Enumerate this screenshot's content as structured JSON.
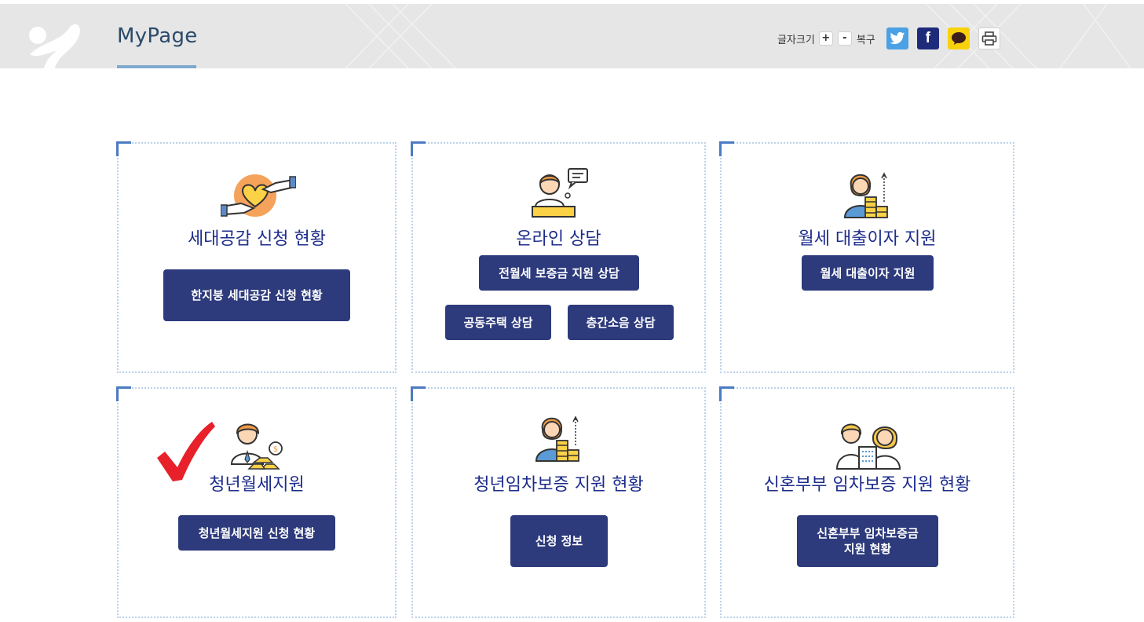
{
  "header": {
    "title": "MyPage",
    "font_size_label": "글자크기",
    "font_plus": "+",
    "font_minus": "-",
    "font_reset": "복구",
    "share_icons": [
      "twitter-icon",
      "facebook-icon",
      "kakaotalk-icon",
      "print-icon"
    ]
  },
  "cards": [
    {
      "title": "세대공감 신청 현황",
      "icon": "heart-handshake-icon",
      "buttons": [
        "한지붕 세대공감 신청 현황"
      ]
    },
    {
      "title": "온라인 상담",
      "icon": "consultant-icon",
      "buttons": [
        "전월세 보증금 지원 상담",
        "공동주택 상담",
        "층간소음 상담"
      ]
    },
    {
      "title": "월세 대출이자 지원",
      "icon": "woman-coins-icon",
      "buttons": [
        "월세 대출이자 지원"
      ]
    },
    {
      "title": "청년월세지원",
      "icon": "man-gold-icon",
      "buttons": [
        "청년월세지원 신청 현황"
      ]
    },
    {
      "title": "청년임차보증 지원 현황",
      "icon": "woman-coins-icon",
      "buttons": [
        "신청 정보"
      ]
    },
    {
      "title": "신혼부부 임차보증 지원 현황",
      "icon": "couple-building-icon",
      "buttons": [
        "신혼부부 임차보증금\n지원 현황"
      ]
    }
  ],
  "annotation": {
    "icon": "red-checkmark-icon",
    "color": "#e8202a"
  },
  "colors": {
    "button": "#2d3a7c",
    "title": "#1d2c8c",
    "accent": "#4b7bc2",
    "header_bg": "#e6e6e6"
  }
}
